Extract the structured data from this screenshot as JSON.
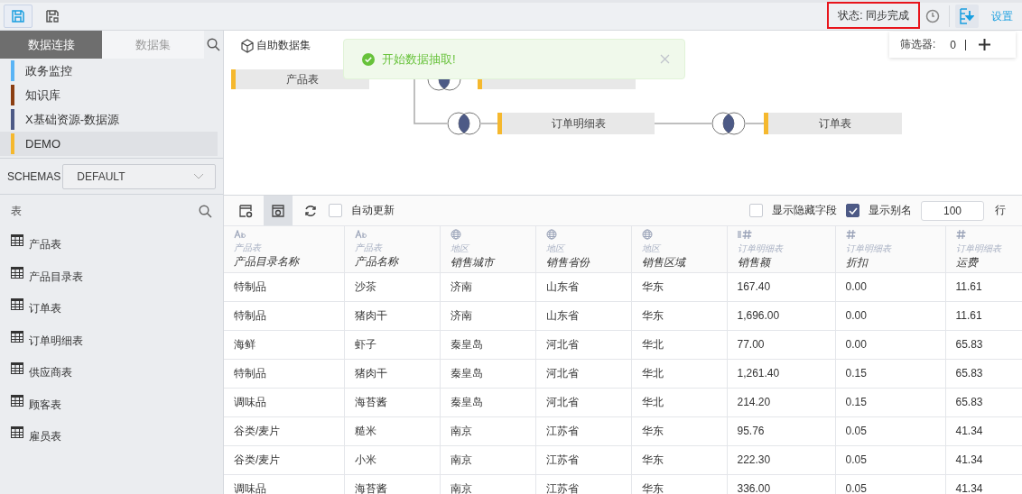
{
  "toolbar": {
    "buttons": [
      {
        "kind": "save",
        "active": true
      },
      {
        "kind": "save-as",
        "active": false
      }
    ],
    "status": {
      "label": "状态: 同步完成",
      "highlighted": true
    },
    "settings_link": "设置"
  },
  "sidebar": {
    "tabs": [
      {
        "label": "数据连接",
        "selected": true
      },
      {
        "label": "数据集",
        "selected": false
      }
    ],
    "sources": [
      {
        "label": "政务监控",
        "color": "#5ab4f5",
        "selected": false
      },
      {
        "label": "知识库",
        "color": "#8b3e12",
        "selected": false
      },
      {
        "label": "X基础资源-数据源",
        "color": "#4d5a86",
        "selected": false
      },
      {
        "label": "DEMO",
        "color": "#f5b82e",
        "selected": true
      }
    ],
    "schemas": {
      "label": "SCHEMAS",
      "value": "DEFAULT"
    },
    "tables": {
      "title": "表",
      "items": [
        "产品表",
        "产品目录表",
        "订单表",
        "订单明细表",
        "供应商表",
        "顾客表",
        "雇员表"
      ]
    }
  },
  "diagram": {
    "title": "自助数据集",
    "nodes": [
      "产品表",
      "订单明细表",
      "订单表"
    ],
    "toast": {
      "message": "开始数据抽取!"
    },
    "filter": {
      "label": "筛选器:",
      "count": "0"
    }
  },
  "grid": {
    "tools": [
      {
        "kind": "settings",
        "active": false
      },
      {
        "kind": "preview",
        "active": true
      },
      {
        "kind": "refresh",
        "active": false
      }
    ],
    "auto_update": {
      "label": "自动更新",
      "checked": false
    },
    "show_hidden": {
      "label": "显示隐藏字段",
      "checked": false
    },
    "show_alias": {
      "label": "显示别名",
      "checked": true
    },
    "row_limit": {
      "value": "100",
      "unit": "行"
    },
    "columns": [
      {
        "kind": "text",
        "source": "产品表",
        "name": "产品目录名称"
      },
      {
        "kind": "text",
        "source": "产品表",
        "name": "产品名称"
      },
      {
        "kind": "geo",
        "source": "地区",
        "name": "销售城市"
      },
      {
        "kind": "geo",
        "source": "地区",
        "name": "销售省份"
      },
      {
        "kind": "geo",
        "source": "地区",
        "name": "销售区域"
      },
      {
        "kind": "measure",
        "source": "订单明细表",
        "name": "销售额"
      },
      {
        "kind": "number",
        "source": "订单明细表",
        "name": "折扣"
      },
      {
        "kind": "number",
        "source": "订单明细表",
        "name": "运费"
      }
    ],
    "rows": [
      [
        "特制品",
        "沙茶",
        "济南",
        "山东省",
        "华东",
        "167.40",
        "0.00",
        "11.61"
      ],
      [
        "特制品",
        "猪肉干",
        "济南",
        "山东省",
        "华东",
        "1,696.00",
        "0.00",
        "11.61"
      ],
      [
        "海鲜",
        "虾子",
        "秦皇岛",
        "河北省",
        "华北",
        "77.00",
        "0.00",
        "65.83"
      ],
      [
        "特制品",
        "猪肉干",
        "秦皇岛",
        "河北省",
        "华北",
        "1,261.40",
        "0.15",
        "65.83"
      ],
      [
        "调味品",
        "海苔酱",
        "秦皇岛",
        "河北省",
        "华北",
        "214.20",
        "0.15",
        "65.83"
      ],
      [
        "谷类/麦片",
        "糙米",
        "南京",
        "江苏省",
        "华东",
        "95.76",
        "0.05",
        "41.34"
      ],
      [
        "谷类/麦片",
        "小米",
        "南京",
        "江苏省",
        "华东",
        "222.30",
        "0.05",
        "41.34"
      ],
      [
        "调味品",
        "海苔酱",
        "南京",
        "江苏省",
        "华东",
        "336.00",
        "0.05",
        "41.34"
      ]
    ]
  }
}
